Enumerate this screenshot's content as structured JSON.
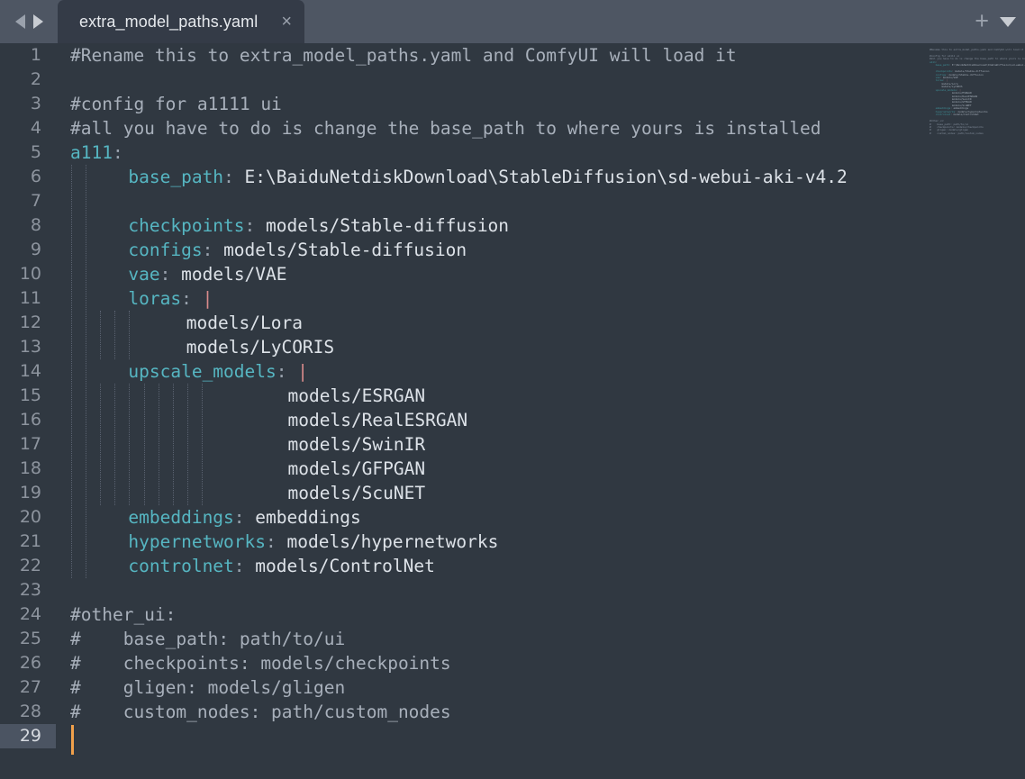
{
  "titlebar": {
    "nav_back_icon": "triangle-left-icon",
    "nav_forward_icon": "triangle-right-icon",
    "add_tab_label": "+",
    "tab_menu_icon": "chevron-down-icon"
  },
  "tab": {
    "label": "extra_model_paths.yaml",
    "close_label": "×"
  },
  "editor": {
    "language": "yaml",
    "active_line": 29,
    "total_lines": 29,
    "caret_line": 29,
    "caret_column": 1,
    "colors": {
      "tabbar_background": "#4e5663",
      "tab_background": "#343b47",
      "editor_background": "#303841",
      "line_number": "#8d949e",
      "active_line_gutter": "#4b5462",
      "comment": "#a8b0bb",
      "key": "#56b6c2",
      "value": "#dde2e8",
      "punctuation": "#9aa3ae",
      "block_scalar": "#d98b8b",
      "caret": "#f0a04b",
      "indent_guide": "#5a6270"
    },
    "lines": [
      {
        "n": 1,
        "indent": 0,
        "tokens": [
          {
            "t": "cmt",
            "s": "#Rename this to extra_model_paths.yaml and ComfyUI will load it"
          }
        ]
      },
      {
        "n": 2,
        "indent": 0,
        "tokens": []
      },
      {
        "n": 3,
        "indent": 0,
        "tokens": [
          {
            "t": "cmt",
            "s": "#config for a1111 ui"
          }
        ]
      },
      {
        "n": 4,
        "indent": 0,
        "tokens": [
          {
            "t": "cmt",
            "s": "#all you have to do is change the base_path to where yours is installed"
          }
        ]
      },
      {
        "n": 5,
        "indent": 0,
        "tokens": [
          {
            "t": "key",
            "s": "a111"
          },
          {
            "t": "colon",
            "s": ":"
          }
        ]
      },
      {
        "n": 6,
        "indent": 4,
        "tokens": [
          {
            "t": "key",
            "s": "base_path"
          },
          {
            "t": "colon",
            "s": ":"
          },
          {
            "t": "val",
            "s": " E:\\BaiduNetdiskDownload\\StableDiffusion\\sd-webui-aki-v4.2"
          }
        ]
      },
      {
        "n": 7,
        "indent": 4,
        "tokens": []
      },
      {
        "n": 8,
        "indent": 4,
        "tokens": [
          {
            "t": "key",
            "s": "checkpoints"
          },
          {
            "t": "colon",
            "s": ":"
          },
          {
            "t": "val",
            "s": " models/Stable-diffusion"
          }
        ]
      },
      {
        "n": 9,
        "indent": 4,
        "tokens": [
          {
            "t": "key",
            "s": "configs"
          },
          {
            "t": "colon",
            "s": ":"
          },
          {
            "t": "val",
            "s": " models/Stable-diffusion"
          }
        ]
      },
      {
        "n": 10,
        "indent": 4,
        "tokens": [
          {
            "t": "key",
            "s": "vae"
          },
          {
            "t": "colon",
            "s": ":"
          },
          {
            "t": "val",
            "s": " models/VAE"
          }
        ]
      },
      {
        "n": 11,
        "indent": 4,
        "tokens": [
          {
            "t": "key",
            "s": "loras"
          },
          {
            "t": "colon",
            "s": ":"
          },
          {
            "t": "val",
            "s": " "
          },
          {
            "t": "pipe",
            "s": "|"
          }
        ]
      },
      {
        "n": 12,
        "indent": 8,
        "tokens": [
          {
            "t": "val",
            "s": "models/Lora"
          }
        ]
      },
      {
        "n": 13,
        "indent": 8,
        "tokens": [
          {
            "t": "val",
            "s": "models/LyCORIS"
          }
        ]
      },
      {
        "n": 14,
        "indent": 4,
        "tokens": [
          {
            "t": "key",
            "s": "upscale_models"
          },
          {
            "t": "colon",
            "s": ":"
          },
          {
            "t": "val",
            "s": " "
          },
          {
            "t": "pipe",
            "s": "|"
          }
        ]
      },
      {
        "n": 15,
        "indent": 15,
        "tokens": [
          {
            "t": "val",
            "s": "models/ESRGAN"
          }
        ]
      },
      {
        "n": 16,
        "indent": 15,
        "tokens": [
          {
            "t": "val",
            "s": "models/RealESRGAN"
          }
        ]
      },
      {
        "n": 17,
        "indent": 15,
        "tokens": [
          {
            "t": "val",
            "s": "models/SwinIR"
          }
        ]
      },
      {
        "n": 18,
        "indent": 15,
        "tokens": [
          {
            "t": "val",
            "s": "models/GFPGAN"
          }
        ]
      },
      {
        "n": 19,
        "indent": 15,
        "tokens": [
          {
            "t": "val",
            "s": "models/ScuNET"
          }
        ]
      },
      {
        "n": 20,
        "indent": 4,
        "tokens": [
          {
            "t": "key",
            "s": "embeddings"
          },
          {
            "t": "colon",
            "s": ":"
          },
          {
            "t": "val",
            "s": " embeddings"
          }
        ]
      },
      {
        "n": 21,
        "indent": 4,
        "tokens": [
          {
            "t": "key",
            "s": "hypernetworks"
          },
          {
            "t": "colon",
            "s": ":"
          },
          {
            "t": "val",
            "s": " models/hypernetworks"
          }
        ]
      },
      {
        "n": 22,
        "indent": 4,
        "tokens": [
          {
            "t": "key",
            "s": "controlnet"
          },
          {
            "t": "colon",
            "s": ":"
          },
          {
            "t": "val",
            "s": " models/ControlNet"
          }
        ]
      },
      {
        "n": 23,
        "indent": 0,
        "tokens": []
      },
      {
        "n": 24,
        "indent": 0,
        "tokens": [
          {
            "t": "cmt",
            "s": "#other_ui:"
          }
        ]
      },
      {
        "n": 25,
        "indent": 0,
        "tokens": [
          {
            "t": "cmt",
            "s": "#    base_path: path/to/ui"
          }
        ]
      },
      {
        "n": 26,
        "indent": 0,
        "tokens": [
          {
            "t": "cmt",
            "s": "#    checkpoints: models/checkpoints"
          }
        ]
      },
      {
        "n": 27,
        "indent": 0,
        "tokens": [
          {
            "t": "cmt",
            "s": "#    gligen: models/gligen"
          }
        ]
      },
      {
        "n": 28,
        "indent": 0,
        "tokens": [
          {
            "t": "cmt",
            "s": "#    custom_nodes: path/custom_nodes"
          }
        ]
      },
      {
        "n": 29,
        "indent": 0,
        "tokens": []
      }
    ],
    "indent_guides": [
      {
        "col": 1,
        "from": 6,
        "to": 22
      },
      {
        "col": 2,
        "from": 6,
        "to": 22
      },
      {
        "col": 3,
        "from": 12,
        "to": 13
      },
      {
        "col": 4,
        "from": 12,
        "to": 13
      },
      {
        "col": 5,
        "from": 12,
        "to": 13
      },
      {
        "col": 3,
        "from": 15,
        "to": 19
      },
      {
        "col": 4,
        "from": 15,
        "to": 19
      },
      {
        "col": 5,
        "from": 15,
        "to": 19
      },
      {
        "col": 6,
        "from": 15,
        "to": 19
      },
      {
        "col": 7,
        "from": 15,
        "to": 19
      },
      {
        "col": 8,
        "from": 15,
        "to": 19
      },
      {
        "col": 9,
        "from": 15,
        "to": 19
      },
      {
        "col": 10,
        "from": 15,
        "to": 19
      }
    ]
  },
  "minimap": {
    "visible": true
  }
}
